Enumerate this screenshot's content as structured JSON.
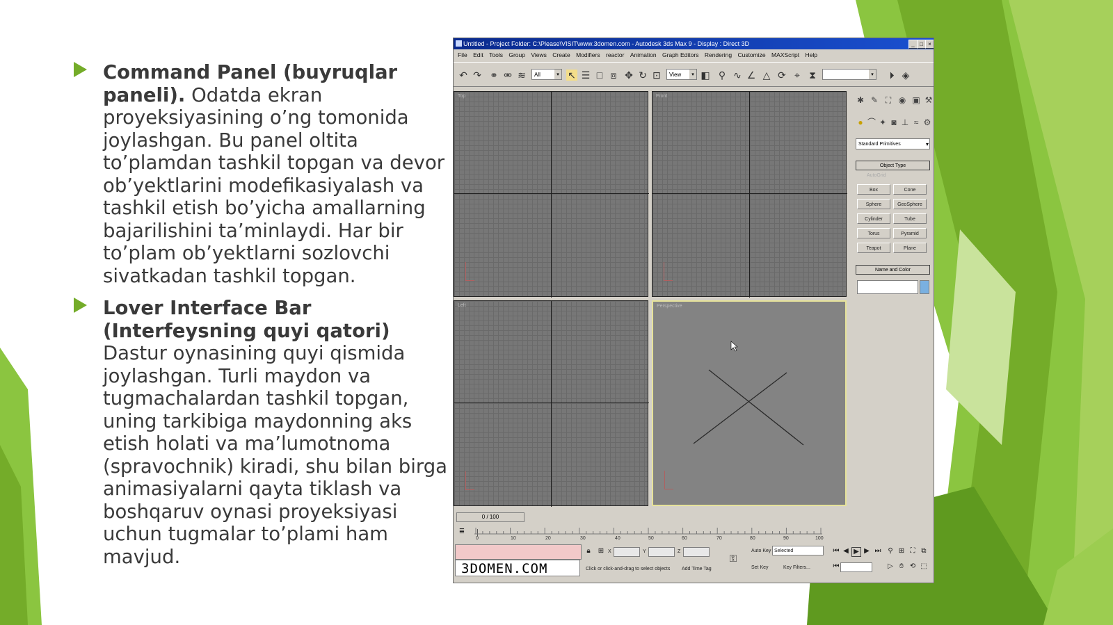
{
  "slide": {
    "bullets": [
      {
        "title": "Command   Panel (buyruqlar paneli).",
        "text": " Odatda ekran proyeksiyasining   o’ng tomonida joylashgan. Bu panel oltita to’plamdan tashkil topgan va devor ob’yektlarini modefikasiyalash  va tashkil  etish  bo’yicha  amallarning bajarilishini  ta’minlaydi.  Har bir to’plam ob’yektlarni sozlovchi sivatkadan tashkil topgan."
      },
      {
        "title": "Lover Interface Bar (Interfeysning quyi qatori)",
        "text": " Dastur oynasining quyi qismida joylashgan. Turli maydon va tugmachalardan tashkil   topgan, uning   tarkibiga maydonning aks etish   holati   va  ma’lumotnoma (spravochnik)  kiradi, shu bilan birga animasiyalarni qayta tiklash va boshqaruv oynasi proyeksiyasi uchun tugmalar to’plami ham mavjud."
      }
    ],
    "accent_color": "#74ac29"
  },
  "app": {
    "title": "Untitled    - Project Folder: C:\\Please\\VISIT\\www.3domen.com    - Autodesk 3ds Max 9    - Display : Direct 3D",
    "window_buttons": [
      "_",
      "□",
      "×"
    ],
    "menu": [
      "File",
      "Edit",
      "Tools",
      "Group",
      "Views",
      "Create",
      "Modifiers",
      "reactor",
      "Animation",
      "Graph Editors",
      "Rendering",
      "Customize",
      "MAXScript",
      "Help"
    ],
    "toolbar": {
      "selection_filter": "All",
      "ref_coord": "View",
      "named_selection": ""
    },
    "viewports": [
      "Top",
      "Front",
      "Left",
      "Perspective"
    ],
    "command_panel": {
      "dropdown": "Standard Primitives",
      "object_type_label": "Object Type",
      "autogrid_label": "AutoGrid",
      "buttons": [
        "Box",
        "Cone",
        "Sphere",
        "GeoSphere",
        "Cylinder",
        "Tube",
        "Torus",
        "Pyramid",
        "Teapot",
        "Plane"
      ],
      "name_color_label": "Name and Color"
    },
    "timeline": {
      "frame_label": "0 / 100",
      "ticks": [
        "0",
        "10",
        "20",
        "30",
        "40",
        "50",
        "60",
        "70",
        "80",
        "90",
        "100"
      ]
    },
    "status": {
      "logo_text": "3DOMEN.COM",
      "prompt": "Click or click-and-drag to select objects",
      "add_time_tag": "Add Time Tag",
      "x_label": "X",
      "y_label": "Y",
      "z_label": "Z",
      "auto_key": "Auto Key",
      "set_key": "Set Key",
      "key_mode": "Selected",
      "key_filters": "Key Filters..."
    }
  }
}
